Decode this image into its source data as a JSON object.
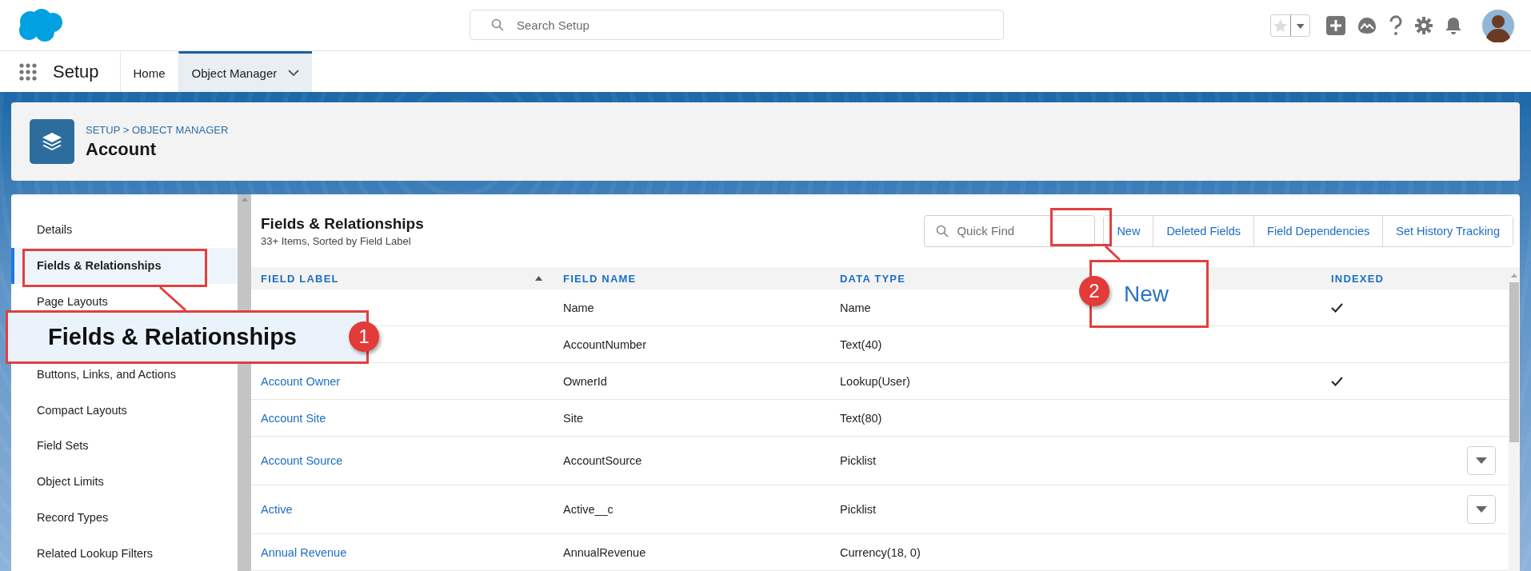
{
  "search": {
    "placeholder": "Search Setup"
  },
  "nav": {
    "app_title": "Setup",
    "tabs": [
      {
        "label": "Home",
        "selected": false
      },
      {
        "label": "Object Manager",
        "selected": true
      }
    ]
  },
  "page_header": {
    "breadcrumb": "SETUP > OBJECT MANAGER",
    "title": "Account"
  },
  "sidebar": {
    "items": [
      {
        "label": "Details",
        "selected": false
      },
      {
        "label": "Fields & Relationships",
        "selected": true
      },
      {
        "label": "Page Layouts",
        "selected": false
      },
      {
        "label": "Buttons, Links, and Actions",
        "selected": false
      },
      {
        "label": "Compact Layouts",
        "selected": false
      },
      {
        "label": "Field Sets",
        "selected": false
      },
      {
        "label": "Object Limits",
        "selected": false
      },
      {
        "label": "Record Types",
        "selected": false
      },
      {
        "label": "Related Lookup Filters",
        "selected": false
      }
    ]
  },
  "content": {
    "title": "Fields & Relationships",
    "subtitle": "33+ Items, Sorted by Field Label",
    "quick_find": {
      "placeholder": "Quick Find"
    },
    "buttons": [
      "New",
      "Deleted Fields",
      "Field Dependencies",
      "Set History Tracking"
    ],
    "table": {
      "columns": [
        {
          "label": "FIELD LABEL",
          "sorted": true
        },
        {
          "label": "FIELD NAME",
          "sorted": false
        },
        {
          "label": "DATA TYPE",
          "sorted": false
        },
        {
          "sorted": false
        },
        {
          "label": "INDEXED",
          "sorted": false
        }
      ],
      "rows": [
        {
          "field_name": "Name",
          "data_type": "Name",
          "indexed": true,
          "menu": false
        },
        {
          "field_name": "AccountNumber",
          "data_type": "Text(40)",
          "indexed": false,
          "menu": false
        },
        {
          "field_label": "Account Owner",
          "field_name": "OwnerId",
          "data_type": "Lookup(User)",
          "indexed": true,
          "menu": false
        },
        {
          "field_label": "Account Site",
          "field_name": "Site",
          "data_type": "Text(80)",
          "indexed": false,
          "menu": false
        },
        {
          "field_label": "Account Source",
          "field_name": "AccountSource",
          "data_type": "Picklist",
          "indexed": false,
          "menu": true
        },
        {
          "field_label": "Active",
          "field_name": "Active__c",
          "data_type": "Picklist",
          "indexed": false,
          "menu": true
        },
        {
          "field_label": "Annual Revenue",
          "field_name": "AnnualRevenue",
          "data_type": "Currency(18, 0)",
          "indexed": false,
          "menu": false
        }
      ]
    }
  },
  "callouts": [
    {
      "number": "1",
      "text": "Fields & Relationships"
    },
    {
      "number": "2",
      "text": "New"
    }
  ]
}
